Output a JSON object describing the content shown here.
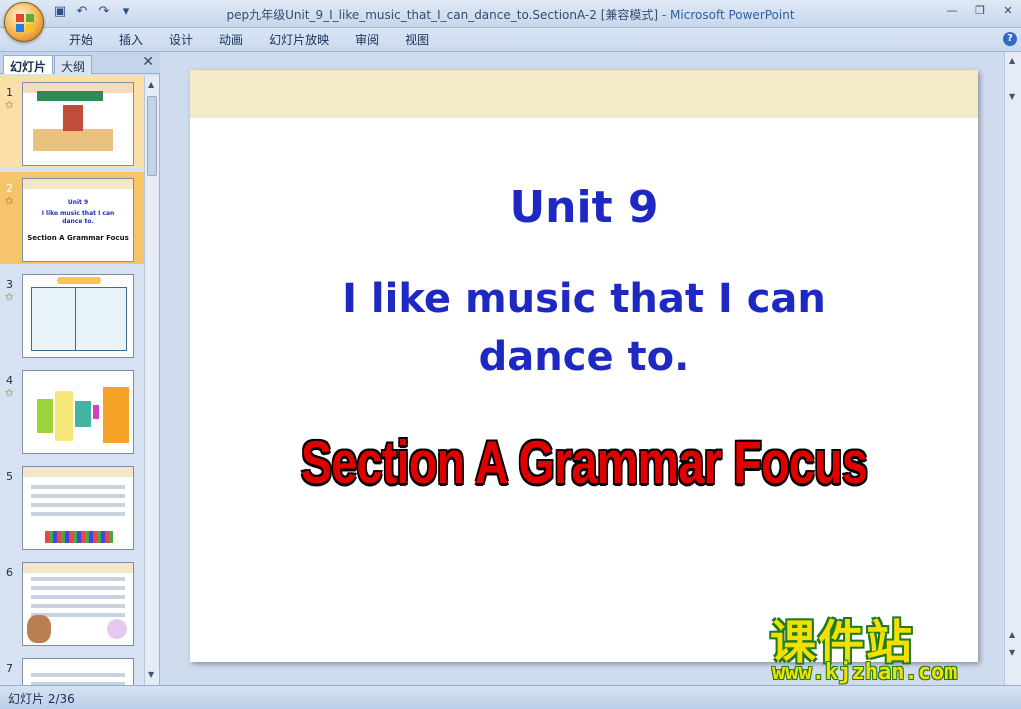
{
  "window": {
    "title": "pep九年级Unit_9_I_like_music_that_I_can_dance_to.SectionA-2 [兼容模式]",
    "separator": " - ",
    "app_name": "Microsoft PowerPoint"
  },
  "ribbon": {
    "tabs": [
      "开始",
      "插入",
      "设计",
      "动画",
      "幻灯片放映",
      "审阅",
      "视图"
    ]
  },
  "panel": {
    "tab_slides": "幻灯片",
    "tab_outline": "大纲",
    "slides": [
      {
        "num": "1"
      },
      {
        "num": "2",
        "t1": "Unit 9",
        "t2": "I like music that I can dance to.",
        "t3": "Section A Grammar  Focus"
      },
      {
        "num": "3"
      },
      {
        "num": "4"
      },
      {
        "num": "5"
      },
      {
        "num": "6"
      },
      {
        "num": "7"
      }
    ]
  },
  "slide": {
    "title1": "Unit 9",
    "title2": "I like music that I can dance to.",
    "title3": "Section A Grammar Focus"
  },
  "watermark": {
    "cn": "课件站",
    "url": "www.kjzhan.com"
  },
  "status": {
    "slide_info": "幻灯片 2/36"
  },
  "colors": {
    "title_blue": "#1d29c2",
    "title_red": "#e00000",
    "selected_slide": "#f6c46b"
  }
}
